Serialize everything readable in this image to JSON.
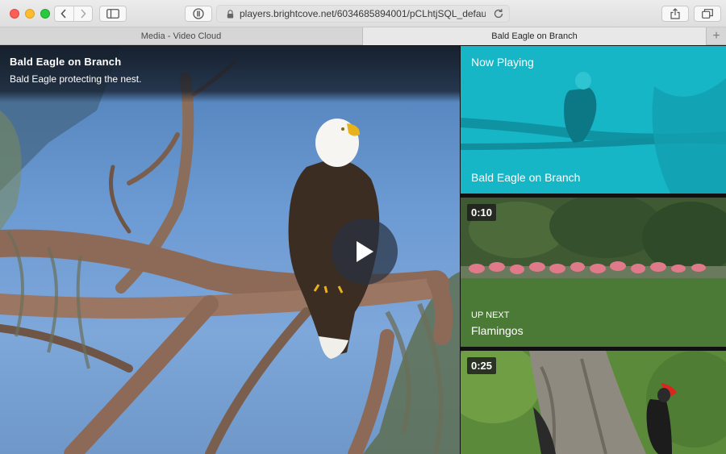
{
  "browser": {
    "url": "players.brightcove.net/6034685894001/pCLhtjSQL_defau",
    "tabs": [
      {
        "label": "Media - Video Cloud",
        "active": false
      },
      {
        "label": "Bald Eagle on Branch",
        "active": true
      }
    ],
    "new_tab_label": "+"
  },
  "player": {
    "title": "Bald Eagle on Branch",
    "description": "Bald Eagle protecting the nest."
  },
  "playlist": {
    "now_playing_label": "Now Playing",
    "now_playing_title": "Bald Eagle on Branch",
    "items": [
      {
        "duration": "0:10",
        "up_next_label": "UP NEXT",
        "title": "Flamingos"
      },
      {
        "duration": "0:25"
      }
    ]
  },
  "colors": {
    "now_playing_tint": "#16b6c6",
    "chrome_bg": "#dedede",
    "close": "#fd5f57",
    "minimize": "#febc2e",
    "maximize": "#28c840"
  },
  "icons": [
    "back-icon",
    "forward-icon",
    "sidebar-icon",
    "password-icon",
    "lock-icon",
    "reload-icon",
    "share-icon",
    "tabs-overview-icon",
    "play-icon"
  ]
}
